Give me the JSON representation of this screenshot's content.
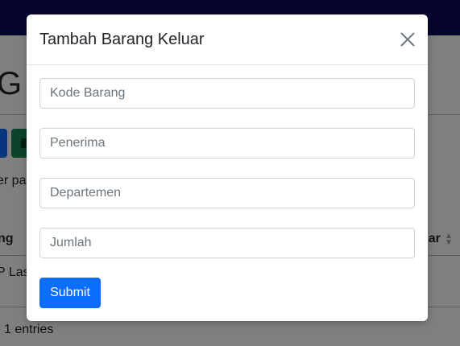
{
  "background": {
    "title_fragment": "G",
    "per_page_fragment": "er pag",
    "table_header_left": "ng",
    "table_header_right": "uar",
    "cell_fragment": "P Las",
    "entries_text": "1 entries"
  },
  "modal": {
    "title": "Tambah Barang Keluar",
    "fields": [
      {
        "placeholder": "Kode Barang",
        "value": ""
      },
      {
        "placeholder": "Penerima",
        "value": ""
      },
      {
        "placeholder": "Departemen",
        "value": ""
      },
      {
        "placeholder": "Jumlah",
        "value": ""
      }
    ],
    "submit_label": "Submit"
  },
  "colors": {
    "navbar": "#0b0b5a",
    "primary": "#0d6efd",
    "success": "#198754"
  },
  "icons": {
    "close": "close-icon",
    "download": "download-icon",
    "sort": "sort-icon"
  }
}
